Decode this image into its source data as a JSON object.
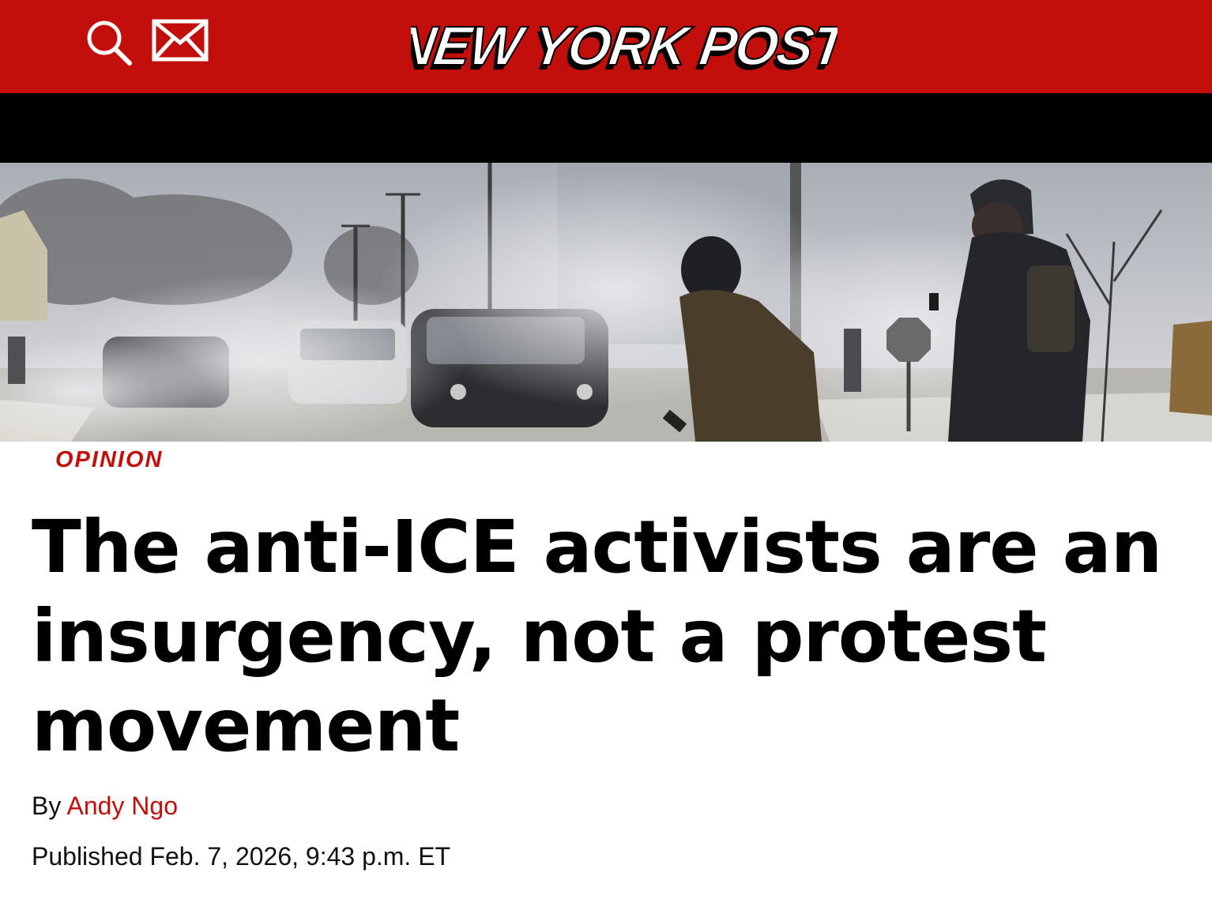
{
  "masthead": {
    "logo_text": "NEW YORK POST",
    "search_icon": "search-icon",
    "mail_icon": "mail-icon"
  },
  "colors": {
    "brand_red": "#c20f0c",
    "nav_black": "#000000"
  },
  "article": {
    "section": "OPINION",
    "headline": "The anti-ICE activists are an insurgency, not a protest movement",
    "byline_prefix": "By",
    "author": "Andy Ngo",
    "published": "Published Feb. 7, 2026, 9:43 p.m. ET"
  }
}
